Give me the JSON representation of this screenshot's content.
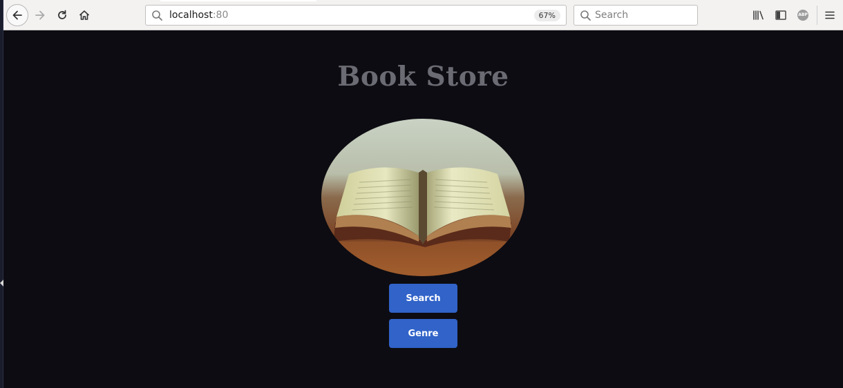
{
  "browser": {
    "url_host": "localhost",
    "url_port": ":80",
    "zoom": "67%",
    "search_placeholder": "Search"
  },
  "page": {
    "title": "Book Store",
    "buttons": {
      "search": "Search",
      "genre": "Genre"
    }
  },
  "icons": [
    "back-icon",
    "forward-icon",
    "reload-icon",
    "home-icon",
    "search-icon",
    "library-icon",
    "sidebar-icon",
    "adblock-icon",
    "menu-icon",
    "book-image"
  ]
}
